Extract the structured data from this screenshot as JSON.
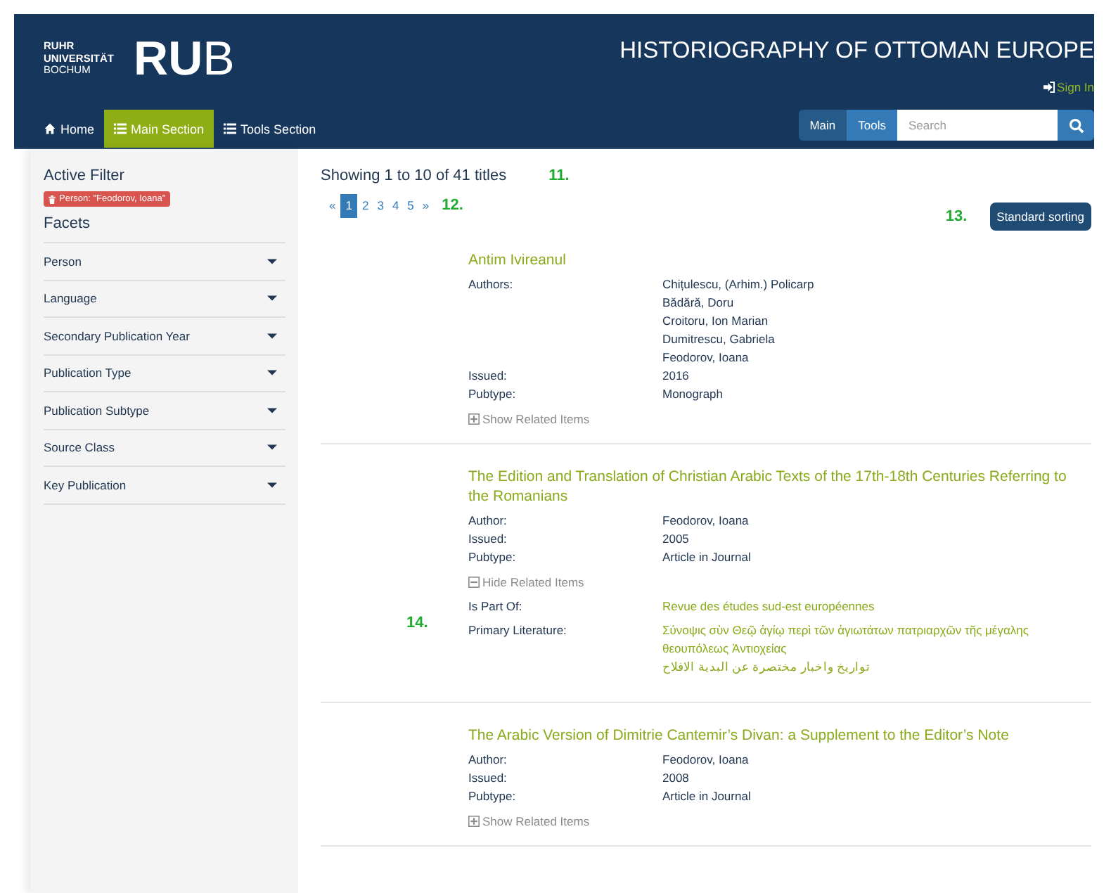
{
  "header": {
    "logo_lines": [
      "RUHR",
      "UNIVERSITÄT",
      "BOCHUM"
    ],
    "logo_mark_bold": "RU",
    "logo_mark_light": "B",
    "title": "HISTORIOGRAPHY OF OTTOMAN EUROPE",
    "sign_in": "Sign In"
  },
  "nav": {
    "items": [
      {
        "label": "Home",
        "selected": false
      },
      {
        "label": "Main Section",
        "selected": true
      },
      {
        "label": "Tools Section",
        "selected": false
      }
    ],
    "scope_buttons": [
      {
        "label": "Main",
        "selected": true
      },
      {
        "label": "Tools",
        "selected": false
      }
    ],
    "search": {
      "placeholder": "Search"
    }
  },
  "sidebar": {
    "active_filter_heading": "Active Filter",
    "active_filters": [
      "Person: \"Feodorov, Ioana\""
    ],
    "facets_heading": "Facets",
    "facets": [
      "Person",
      "Language",
      "Secondary Publication Year",
      "Publication Type",
      "Publication Subtype",
      "Source Class",
      "Key Publication"
    ]
  },
  "results": {
    "summary": "Showing 1 to 10 of 41 titles",
    "summary_marker": "11.",
    "pagination": [
      {
        "label": "«",
        "selected": false
      },
      {
        "label": "1",
        "selected": true
      },
      {
        "label": "2",
        "selected": false
      },
      {
        "label": "3",
        "selected": false
      },
      {
        "label": "4",
        "selected": false
      },
      {
        "label": "5",
        "selected": false
      },
      {
        "label": "»",
        "selected": false
      }
    ],
    "pagination_marker": "12.",
    "sort_marker": "13.",
    "sort_button": "Standard sorting",
    "records": [
      {
        "title": "Antim Ivireanul",
        "fields": [
          {
            "label": "Authors:",
            "values": [
              "Chițulescu, (Arhim.) Policarp",
              "Bădără, Doru",
              "Croitoru, Ion Marian",
              "Dumitrescu, Gabriela",
              "Feodorov, Ioana"
            ]
          },
          {
            "label": "Issued:",
            "values": [
              "2016"
            ]
          },
          {
            "label": "Pubtype:",
            "values": [
              "Monograph"
            ]
          }
        ],
        "related_toggle": {
          "label": "Show Related Items",
          "expanded": false
        }
      },
      {
        "title": "The Edition and Translation of Christian Arabic Texts of the 17th-18th Centuries Referring to the Romanians",
        "fields": [
          {
            "label": "Author:",
            "values": [
              "Feodorov, Ioana"
            ]
          },
          {
            "label": "Issued:",
            "values": [
              "2005"
            ]
          },
          {
            "label": "Pubtype:",
            "values": [
              "Article in Journal"
            ]
          }
        ],
        "related_toggle": {
          "label": "Hide Related Items",
          "expanded": true
        },
        "related_marker": "14.",
        "related": [
          {
            "label": "Is Part Of:",
            "values": [
              "Revue des études sud-est européennes"
            ]
          },
          {
            "label": "Primary Literature:",
            "values": [
              "Σύνοψις σὺν Θεῷ ἁγίῳ περὶ τῶν ἁγιωτάτων πατριαρχῶν τῆς μέγαλης θεουπόλεως Ἀντιοχείας",
              "تواريخ واخبار مختصرة عن البدية الافلاح"
            ]
          }
        ]
      },
      {
        "title": "The Arabic Version of Dimitrie Cantemir’s Divan: a Supplement to the Editor’s Note",
        "fields": [
          {
            "label": "Author:",
            "values": [
              "Feodorov, Ioana"
            ]
          },
          {
            "label": "Issued:",
            "values": [
              "2008"
            ]
          },
          {
            "label": "Pubtype:",
            "values": [
              "Article in Journal"
            ]
          }
        ],
        "related_toggle": {
          "label": "Show Related Items",
          "expanded": false
        }
      }
    ]
  }
}
